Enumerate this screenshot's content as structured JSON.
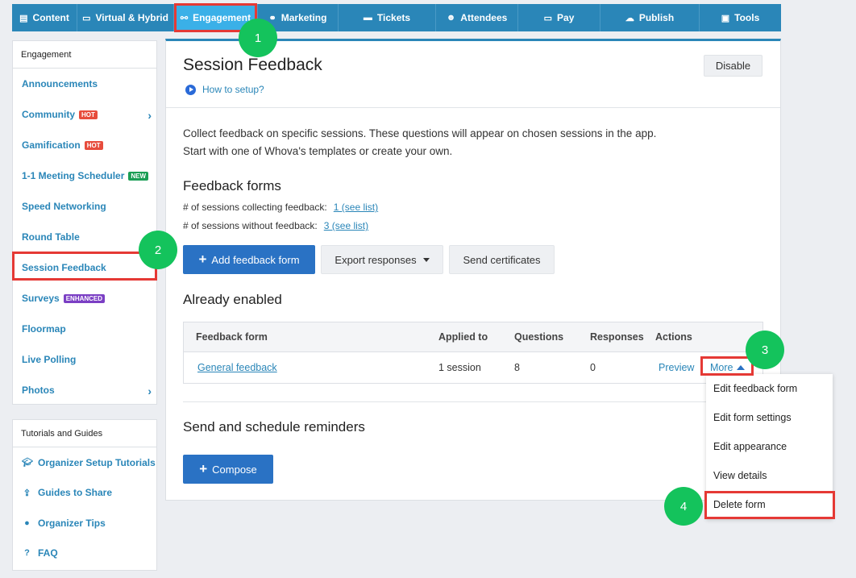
{
  "topnav": {
    "items": [
      {
        "label": "Content",
        "icon": "list-icon"
      },
      {
        "label": "Virtual & Hybrid",
        "icon": "laptop-icon"
      },
      {
        "label": "Engagement",
        "icon": "network-icon"
      },
      {
        "label": "Marketing",
        "icon": "megaphone-icon"
      },
      {
        "label": "Tickets",
        "icon": "ticket-icon"
      },
      {
        "label": "Attendees",
        "icon": "users-icon"
      },
      {
        "label": "Pay",
        "icon": "card-icon"
      },
      {
        "label": "Publish",
        "icon": "cloud-upload-icon"
      },
      {
        "label": "Tools",
        "icon": "toolbox-icon"
      }
    ],
    "active": "Engagement"
  },
  "sidebar": {
    "header": "Engagement",
    "items": [
      {
        "label": "Announcements"
      },
      {
        "label": "Community",
        "badge": "HOT"
      },
      {
        "label": "Gamification",
        "badge": "HOT"
      },
      {
        "label": "1-1 Meeting Scheduler",
        "badge": "NEW"
      },
      {
        "label": "Speed Networking"
      },
      {
        "label": "Round Table"
      },
      {
        "label": "Session Feedback"
      },
      {
        "label": "Surveys",
        "badge": "ENHANCED"
      },
      {
        "label": "Floormap"
      },
      {
        "label": "Live Polling"
      },
      {
        "label": "Photos"
      }
    ]
  },
  "tutorials": {
    "header": "Tutorials and Guides",
    "items": [
      {
        "label": "Organizer Setup Tutorials",
        "icon": "graduation-cap-icon"
      },
      {
        "label": "Guides to Share",
        "icon": "share-icon"
      },
      {
        "label": "Organizer Tips",
        "icon": "lightbulb-icon"
      },
      {
        "label": "FAQ",
        "icon": "question-icon"
      }
    ]
  },
  "main": {
    "title": "Session Feedback",
    "how_to": "How to setup?",
    "disable_label": "Disable",
    "description": "Collect feedback on specific sessions. These questions will appear on chosen sessions in the app. Start with one of Whova's templates or create your own.",
    "feedback_forms_title": "Feedback forms",
    "collecting_label": "# of sessions collecting feedback:",
    "collecting_link": "1 (see list)",
    "without_label": "# of sessions without feedback:",
    "without_link": "3 (see list)",
    "add_form_label": "Add feedback form",
    "export_label": "Export responses",
    "certificates_label": "Send certificates",
    "already_enabled_title": "Already enabled",
    "table": {
      "headers": [
        "Feedback form",
        "Applied to",
        "Questions",
        "Responses",
        "Actions"
      ],
      "rows": [
        {
          "form": "General feedback",
          "applied": "1 session",
          "questions": "8",
          "responses": "0",
          "preview": "Preview",
          "more": "More"
        }
      ]
    },
    "reminders_title": "Send and schedule reminders",
    "compose_label": "Compose"
  },
  "more_menu": {
    "items": [
      "Edit feedback form",
      "Edit form settings",
      "Edit appearance",
      "View details",
      "Delete form"
    ]
  },
  "step_badges": [
    "1",
    "2",
    "3",
    "4"
  ],
  "colors": {
    "nav_bg": "#2a86b8",
    "nav_active": "#3ab0e8",
    "primary": "#2a72c4",
    "highlight": "#e53935",
    "step_badge": "#14c35c"
  }
}
